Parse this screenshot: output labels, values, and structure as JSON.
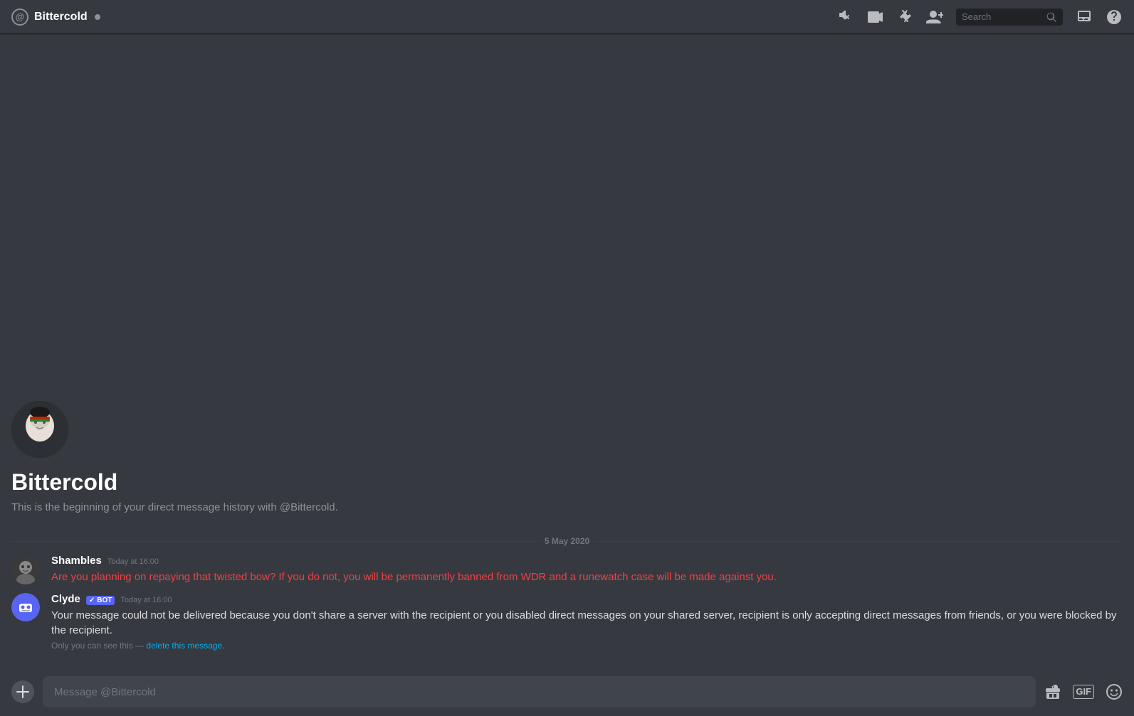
{
  "header": {
    "title": "Bittercold",
    "status_indicator": "online",
    "search_placeholder": "Search",
    "icons": {
      "mute": "🔕",
      "video": "📹",
      "pin": "📌",
      "add_friend": "➕",
      "mention": "@",
      "help": "?"
    }
  },
  "dm_intro": {
    "user_name": "Bittercold",
    "description_start": "This is the beginning of your direct message history with ",
    "mention": "@Bittercold",
    "description_end": "."
  },
  "date_divider": {
    "text": "5 May 2020"
  },
  "messages": [
    {
      "id": "msg1",
      "author": "Shambles",
      "timestamp": "Today at 16:00",
      "text": "Are you planning on repaying that twisted bow? If you do not, you will be permanently banned from WDR and a runewatch case will be made against you.",
      "is_red": true,
      "is_bot": false,
      "system_note": null
    },
    {
      "id": "msg2",
      "author": "Clyde",
      "timestamp": "Today at 16:00",
      "text": "Your message could not be delivered because you don't share a server with the recipient or you disabled direct messages on your shared server, recipient is only accepting direct messages from friends, or you were blocked by the recipient.",
      "is_red": false,
      "is_bot": true,
      "system_note": "Only you can see this — delete this message."
    }
  ],
  "input": {
    "placeholder": "Message @Bittercold"
  },
  "labels": {
    "bot_badge": "BOT",
    "only_you_see": "Only you can see this — ",
    "delete_link": "delete this message."
  }
}
